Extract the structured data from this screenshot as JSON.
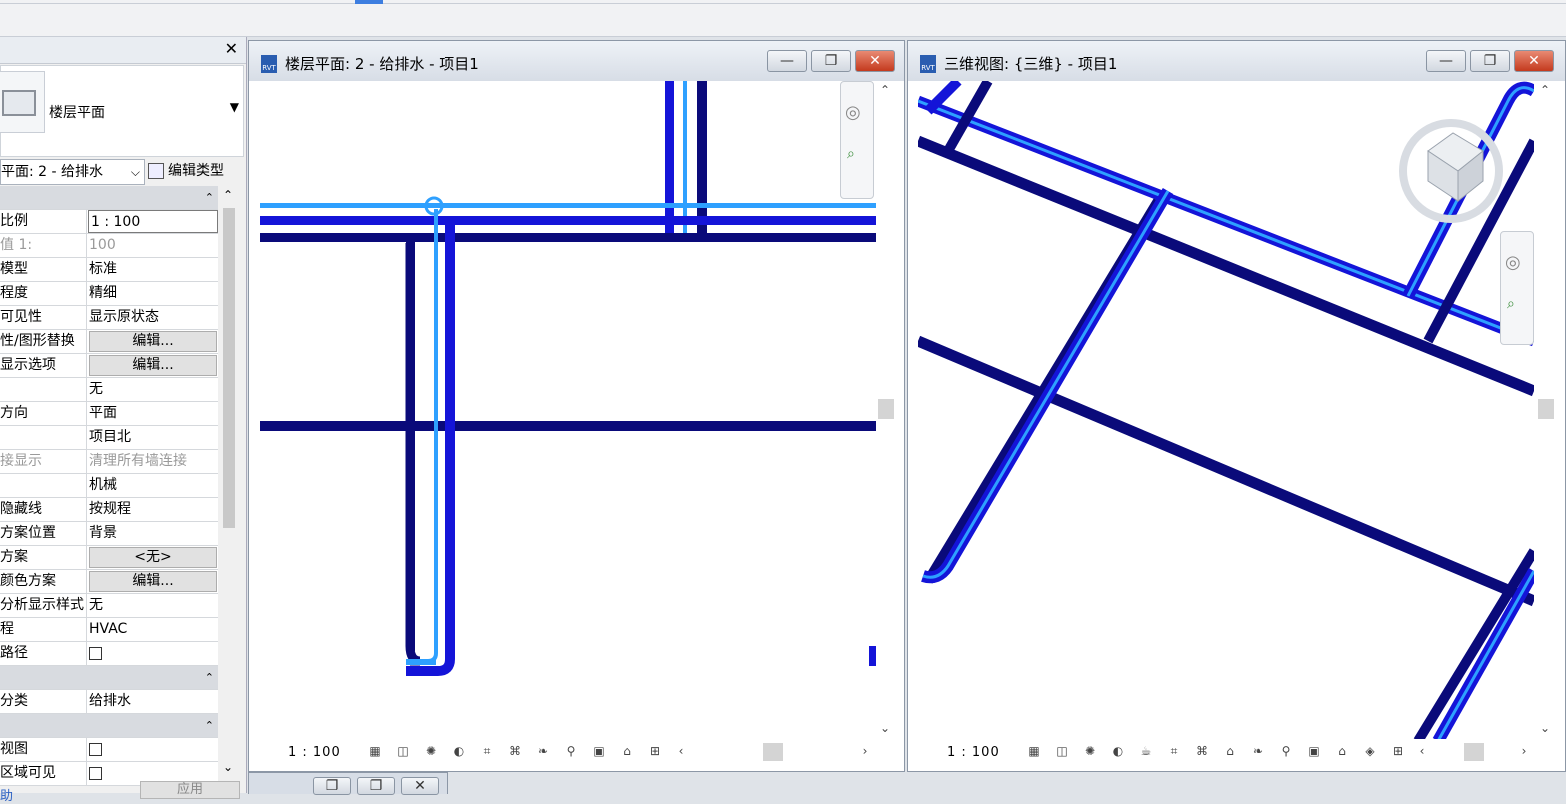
{
  "properties": {
    "type_name": "楼层平面",
    "view_selector": "平面: 2 - 给排水",
    "edit_type_label": "编辑类型",
    "rows": [
      {
        "key": "比例",
        "value": "1 : 100",
        "kind": "input"
      },
      {
        "key": "值 1:",
        "value": "100",
        "kind": "grey"
      },
      {
        "key": "模型",
        "value": "标准",
        "kind": "text"
      },
      {
        "key": "程度",
        "value": "精细",
        "kind": "text"
      },
      {
        "key": "可见性",
        "value": "显示原状态",
        "kind": "text"
      },
      {
        "key": "性/图形替换",
        "value": "编辑...",
        "kind": "button"
      },
      {
        "key": "显示选项",
        "value": "编辑...",
        "kind": "button"
      },
      {
        "key": "",
        "value": "无",
        "kind": "text"
      },
      {
        "key": "方向",
        "value": "平面",
        "kind": "text"
      },
      {
        "key": "",
        "value": "项目北",
        "kind": "text"
      },
      {
        "key": "接显示",
        "value": "清理所有墙连接",
        "kind": "grey"
      },
      {
        "key": "",
        "value": "机械",
        "kind": "text"
      },
      {
        "key": "隐藏线",
        "value": "按规程",
        "kind": "text"
      },
      {
        "key": "方案位置",
        "value": "背景",
        "kind": "text"
      },
      {
        "key": "方案",
        "value": "<无>",
        "kind": "button"
      },
      {
        "key": "颜色方案",
        "value": "编辑...",
        "kind": "button"
      },
      {
        "key": "分析显示样式",
        "value": "无",
        "kind": "text"
      },
      {
        "key": "程",
        "value": "HVAC",
        "kind": "text"
      },
      {
        "key": "路径",
        "value": "",
        "kind": "check"
      },
      {
        "key": "",
        "value": "",
        "kind": "section"
      },
      {
        "key": "分类",
        "value": "给排水",
        "kind": "text"
      },
      {
        "key": "",
        "value": "",
        "kind": "section"
      },
      {
        "key": "视图",
        "value": "",
        "kind": "check"
      },
      {
        "key": "区域可见",
        "value": "",
        "kind": "check"
      }
    ],
    "apply_label": "应用",
    "help_label": "助"
  },
  "views": {
    "plan": {
      "title": "楼层平面: 2 - 给排水 - 项目1",
      "scale": "1 : 100"
    },
    "threed": {
      "title": "三维视图: {三维} - 项目1",
      "scale": "1 : 100"
    }
  },
  "window_buttons": {
    "minimize": "—",
    "restore": "❐",
    "close": "✕"
  },
  "colors": {
    "pipe_dark": "#0a0a7a",
    "pipe_blue": "#1414d8",
    "pipe_light": "#2ea0ff",
    "close_red": "#c43a1e"
  },
  "icons": [
    "detail-level-icon",
    "visual-style-icon",
    "sun-path-icon",
    "shadows-icon",
    "crop-view-icon",
    "show-crop-icon",
    "temp-hide-icon",
    "reveal-hidden-icon",
    "lock-3d-icon",
    "analysis-icon",
    "highlight-icon"
  ]
}
